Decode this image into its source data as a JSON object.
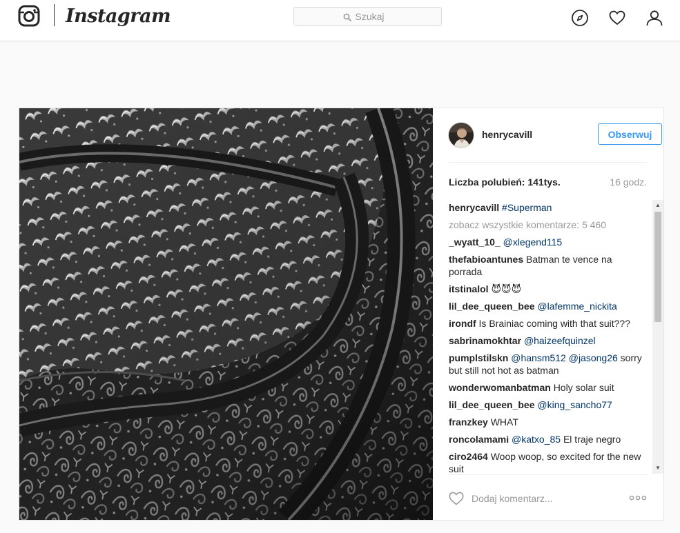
{
  "nav": {
    "brand": "Instagram",
    "search_placeholder": "Szukaj",
    "icons": [
      "instagram-camera-icon",
      "explore-compass-icon",
      "activity-heart-icon",
      "profile-person-icon"
    ]
  },
  "post": {
    "image_description": "black and white close-up of embossed ornamental armor pattern",
    "author": "henrycavill",
    "follow_label": "Obserwuj",
    "likes_label": "Liczba polubień: 141tys.",
    "time_ago": "16 godz.",
    "caption": {
      "user": "henrycavill",
      "text": "#Superman"
    },
    "view_all_comments": "zobacz wszystkie komentarze: 5 460",
    "comments": [
      {
        "user": "_wyatt_10_",
        "mentions": "@xlegend115",
        "text": ""
      },
      {
        "user": "thefabioantunes",
        "mentions": "",
        "text": "Batman te vence na porrada"
      },
      {
        "user": "itstinalol",
        "mentions": "",
        "text": "😈😈😈"
      },
      {
        "user": "lil_dee_queen_bee",
        "mentions": "@lafemme_nickita",
        "text": ""
      },
      {
        "user": "irondf",
        "mentions": "",
        "text": "Is Brainiac coming with that suit???"
      },
      {
        "user": "sabrinamokhtar",
        "mentions": "@haizeefquinzel",
        "text": ""
      },
      {
        "user": "pumplstilskn",
        "mentions": "@hansm512 @jasong26",
        "text": "sorry but still not hot as batman"
      },
      {
        "user": "wonderwomanbatman",
        "mentions": "",
        "text": "Holy solar suit"
      },
      {
        "user": "lil_dee_queen_bee",
        "mentions": "@king_sancho77",
        "text": ""
      },
      {
        "user": "franzkey",
        "mentions": "",
        "text": "WHAT"
      },
      {
        "user": "roncolamami",
        "mentions": "@katxo_85",
        "text": "El traje negro"
      },
      {
        "user": "ciro2464",
        "mentions": "",
        "text": "Woop woop, so excited for the new suit"
      }
    ],
    "add_comment_placeholder": "Dodaj komentarz..."
  },
  "colors": {
    "accent": "#3897f0",
    "mention": "#003569",
    "muted": "#999999",
    "text": "#262626",
    "border": "#dbdbdb"
  }
}
